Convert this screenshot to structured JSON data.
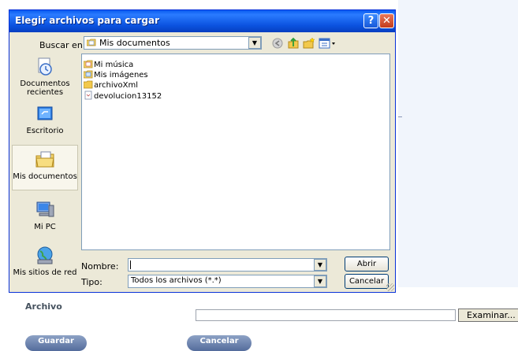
{
  "dialog": {
    "title": "Elegir archivos para cargar",
    "help_symbol": "?",
    "close_symbol": "✕"
  },
  "lookin": {
    "label": "Buscar en:",
    "value": "Mis documentos",
    "dropdown_glyph": "▼",
    "toolbar_icons": [
      "back-icon",
      "up-folder-icon",
      "new-folder-icon",
      "view-menu-icon"
    ]
  },
  "places": [
    {
      "label": "Documentos recientes",
      "icon": "recent-documents-icon"
    },
    {
      "label": "Escritorio",
      "icon": "desktop-icon"
    },
    {
      "label": "Mis documentos",
      "icon": "my-documents-icon",
      "selected": true
    },
    {
      "label": "Mi PC",
      "icon": "my-computer-icon"
    },
    {
      "label": "Mis sitios de red",
      "icon": "network-places-icon"
    }
  ],
  "files": [
    {
      "name": "Mi música",
      "icon": "music-folder-icon"
    },
    {
      "name": "Mis imágenes",
      "icon": "pictures-folder-icon"
    },
    {
      "name": "archivoXml",
      "icon": "folder-icon"
    },
    {
      "name": "devolucion13152",
      "icon": "xml-file-icon"
    }
  ],
  "filename": {
    "label": "Nombre:",
    "value": ""
  },
  "filetype": {
    "label": "Tipo:",
    "value": "Todos los archivos (*.*)"
  },
  "buttons": {
    "open": "Abrir",
    "cancel": "Cancelar"
  },
  "page": {
    "archivo_label": "Archivo",
    "browse_button": "Examinar...",
    "save_button": "Guardar",
    "cancel_button": "Cancelar"
  },
  "colors": {
    "titlebar": "#0a5bf0",
    "dialog_bg": "#ece9d8",
    "page_button": "#6b80ad",
    "page_panel": "#f1f5fc"
  }
}
